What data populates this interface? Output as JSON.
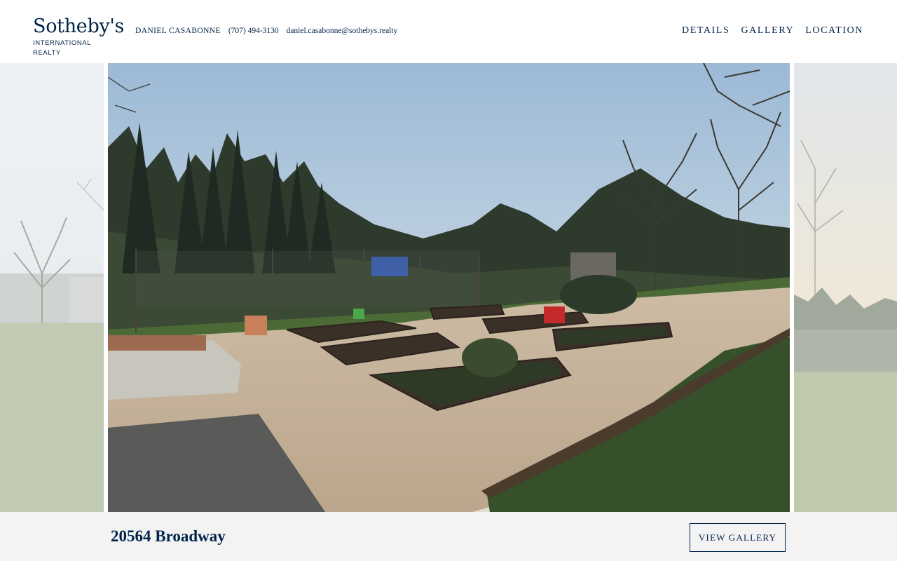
{
  "brand": {
    "name": "Sotheby's",
    "subtitle": "INTERNATIONAL REALTY"
  },
  "agent": {
    "name": "DANIEL CASABONNE",
    "phone": "(707) 494-3130",
    "email": "daniel.casabonne@sothebys.realty"
  },
  "nav": {
    "items": [
      {
        "label": "DETAILS"
      },
      {
        "label": "GALLERY"
      },
      {
        "label": "LOCATION"
      }
    ]
  },
  "hero": {
    "main_image": "backyard garden with raised planter beds",
    "prev_image": "misty field with bare tree",
    "next_image": "field at sunset with trees"
  },
  "listing": {
    "address": "20564 Broadway",
    "view_gallery_label": "VIEW GALLERY"
  },
  "colors": {
    "brand_navy": "#002349",
    "bottom_bar": "#f3f3f3"
  }
}
